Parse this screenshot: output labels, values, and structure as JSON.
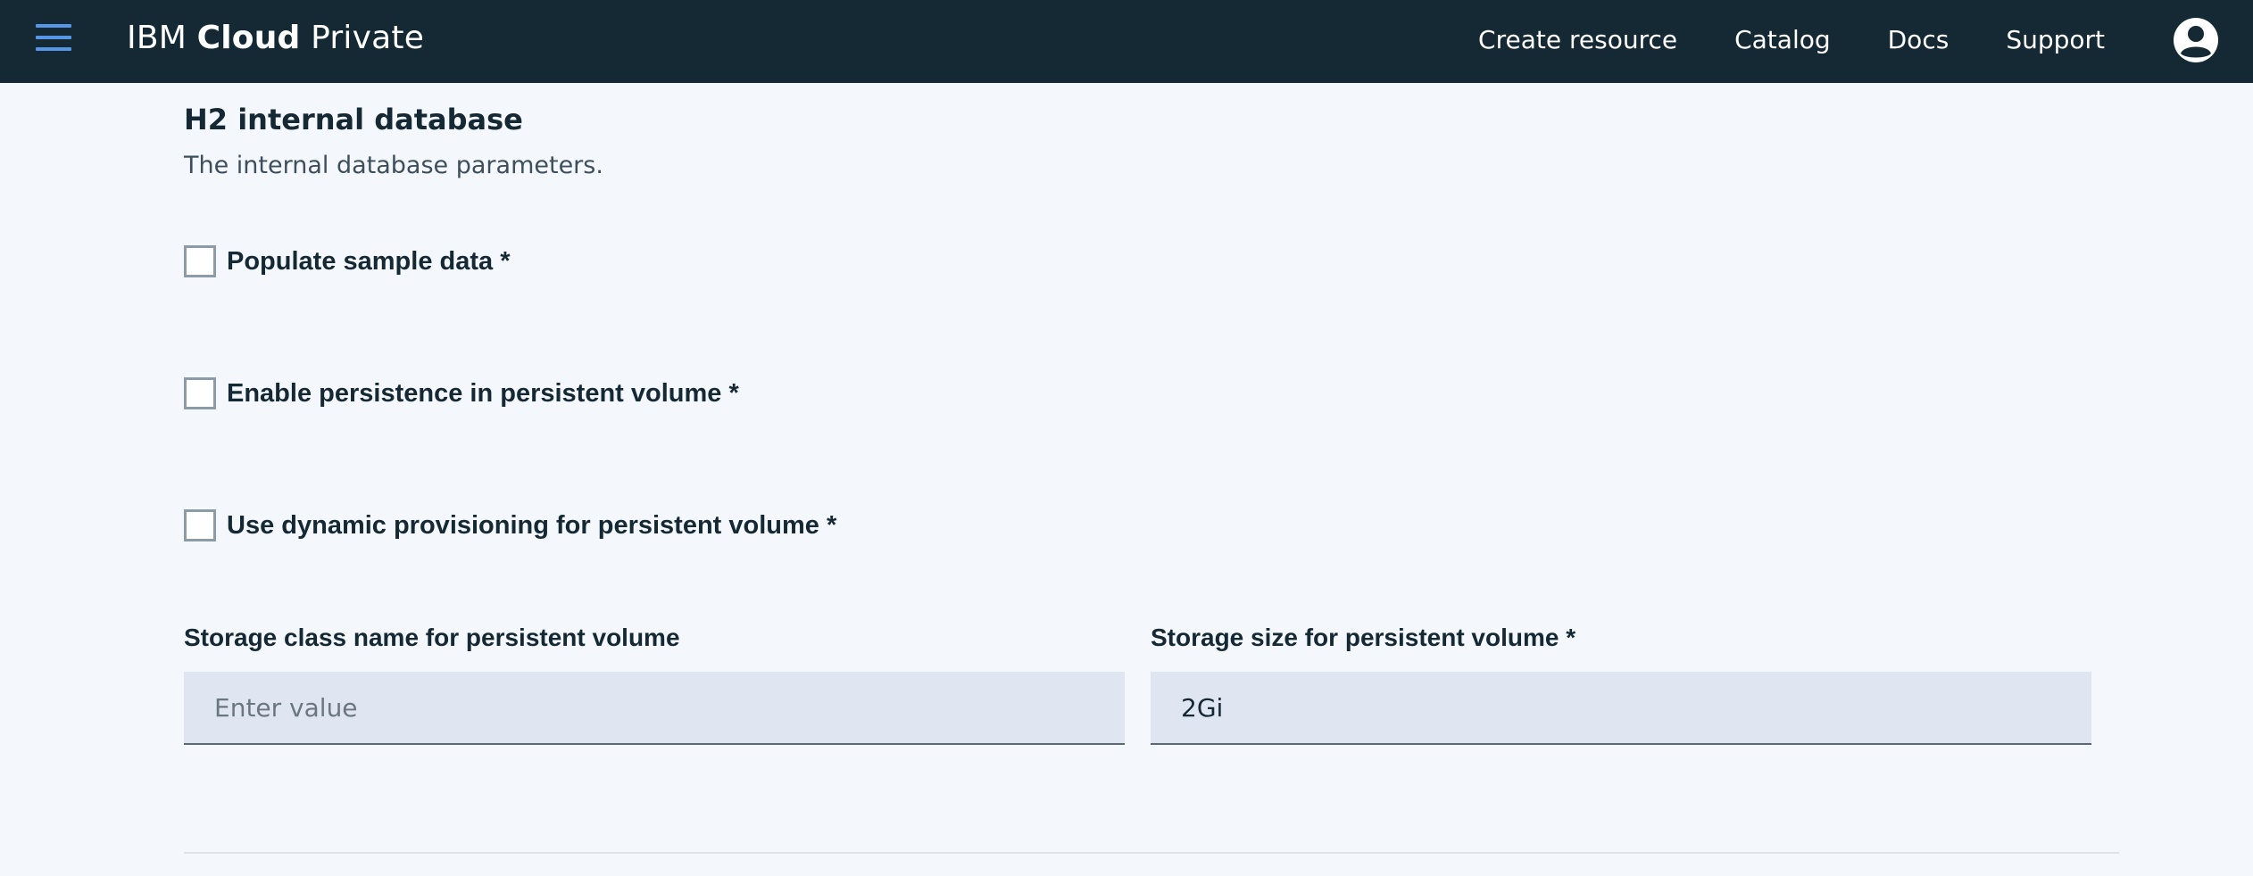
{
  "header": {
    "brand_prefix": "IBM ",
    "brand_bold": "Cloud",
    "brand_suffix": " Private",
    "nav": [
      {
        "label": "Create resource"
      },
      {
        "label": "Catalog"
      },
      {
        "label": "Docs"
      },
      {
        "label": "Support"
      }
    ],
    "menu_icon": "hamburger-menu-icon",
    "avatar_icon": "user-avatar-icon"
  },
  "section": {
    "title": "H2 internal database",
    "description": "The internal database parameters."
  },
  "checkboxes": [
    {
      "label": "Populate sample data *",
      "checked": false
    },
    {
      "label": "Enable persistence in persistent volume *",
      "checked": false
    },
    {
      "label": "Use dynamic provisioning for persistent volume *",
      "checked": false
    }
  ],
  "fields": {
    "storage_class": {
      "label": "Storage class name for persistent volume",
      "value": "",
      "placeholder": "Enter value"
    },
    "storage_size": {
      "label": "Storage size for persistent volume *",
      "value": "2Gi",
      "placeholder": ""
    }
  },
  "colors": {
    "header_bg": "#152935",
    "accent": "#5596e6",
    "page_bg": "#f4f7fb",
    "input_bg": "#dfe6f1"
  }
}
